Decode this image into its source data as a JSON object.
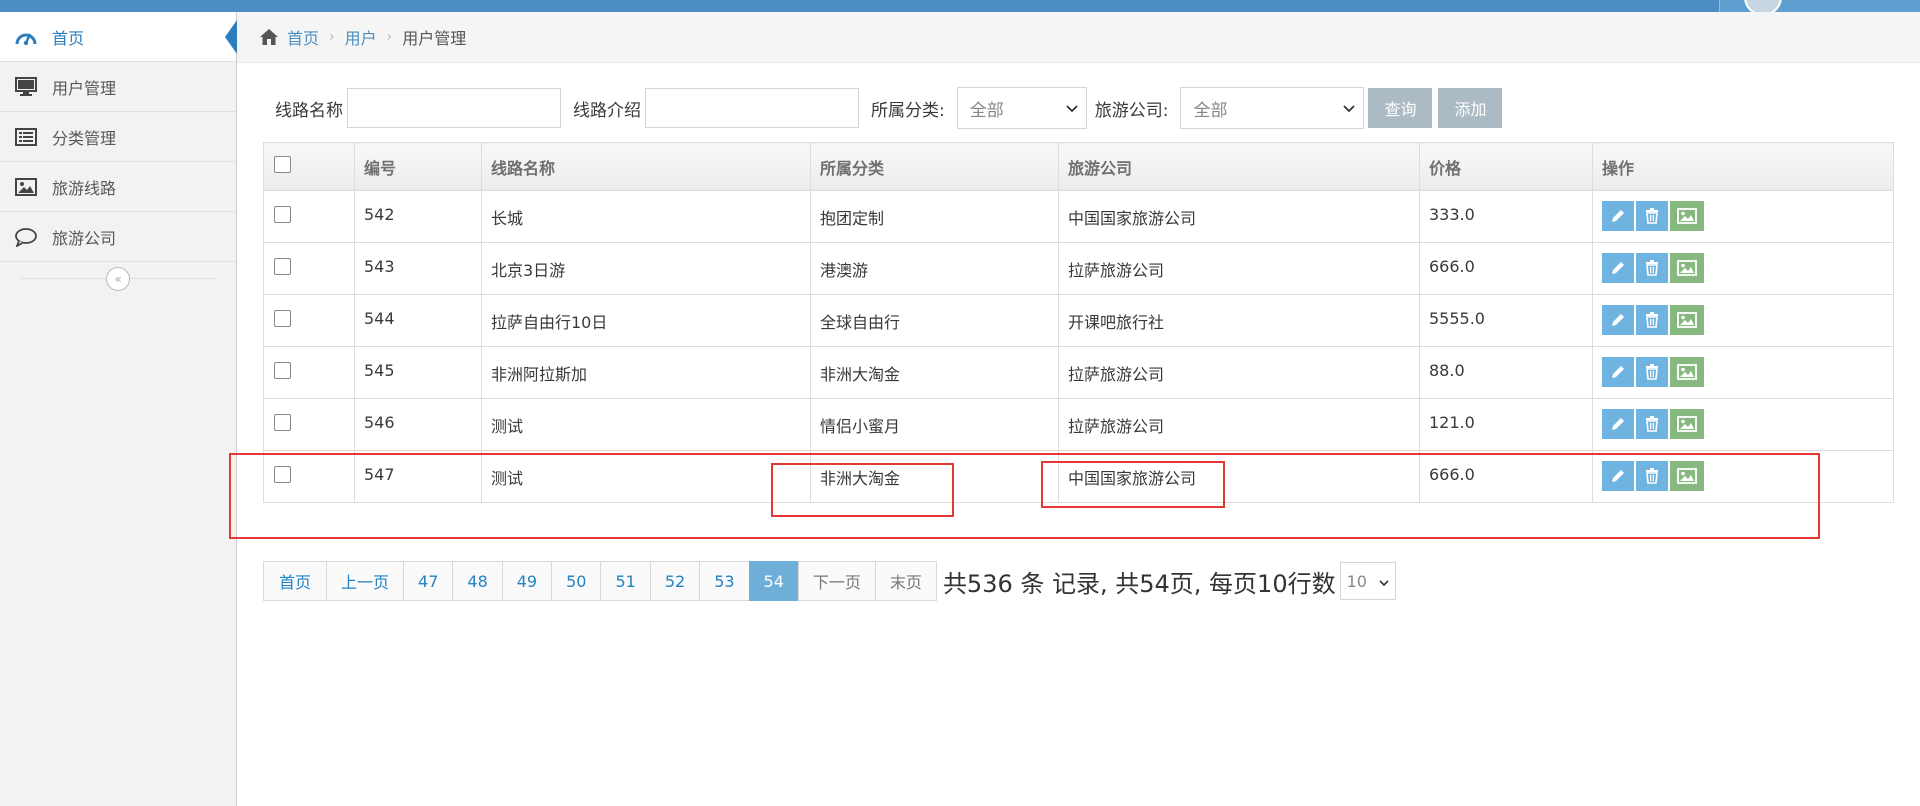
{
  "sidebar": {
    "items": [
      {
        "label": "首页",
        "icon": "dashboard-icon",
        "active": true
      },
      {
        "label": "用户管理",
        "icon": "monitor-icon"
      },
      {
        "label": "分类管理",
        "icon": "list-icon"
      },
      {
        "label": "旅游线路",
        "icon": "picture-icon"
      },
      {
        "label": "旅游公司",
        "icon": "comment-icon"
      }
    ]
  },
  "breadcrumb": {
    "home": "首页",
    "level1": "用户",
    "current": "用户管理"
  },
  "search": {
    "route_name_label": "线路名称",
    "route_intro_label": "线路介绍",
    "category_label": "所属分类:",
    "category_value": "全部",
    "company_label": "旅游公司:",
    "company_value": "全部",
    "query_button": "查询",
    "add_button": "添加"
  },
  "table": {
    "headers": [
      "编号",
      "线路名称",
      "所属分类",
      "旅游公司",
      "价格",
      "操作"
    ],
    "rows": [
      {
        "id": "542",
        "name": "长城",
        "category": "抱团定制",
        "company": "中国国家旅游公司",
        "price": "333.0"
      },
      {
        "id": "543",
        "name": "北京3日游",
        "category": "港澳游",
        "company": "拉萨旅游公司",
        "price": "666.0"
      },
      {
        "id": "544",
        "name": "拉萨自由行10日",
        "category": "全球自由行",
        "company": "开课吧旅行社",
        "price": "5555.0"
      },
      {
        "id": "545",
        "name": "非洲阿拉斯加",
        "category": "非洲大淘金",
        "company": "拉萨旅游公司",
        "price": "88.0"
      },
      {
        "id": "546",
        "name": "测试",
        "category": "情侣小蜜月",
        "company": "拉萨旅游公司",
        "price": "121.0"
      },
      {
        "id": "547",
        "name": "测试",
        "category": "非洲大淘金",
        "company": "中国国家旅游公司",
        "price": "666.0"
      }
    ]
  },
  "pagination": {
    "first": "首页",
    "prev": "上一页",
    "pages": [
      "47",
      "48",
      "49",
      "50",
      "51",
      "52",
      "53",
      "54"
    ],
    "current": "54",
    "next": "下一页",
    "last": "末页",
    "summary": "共536 条 记录, 共54页, 每页10行数",
    "page_size": "10"
  },
  "colors": {
    "accent": "#2b7dbc",
    "annotation": "#e53935",
    "edit": "#6fb3e0",
    "image": "#87b87f"
  }
}
